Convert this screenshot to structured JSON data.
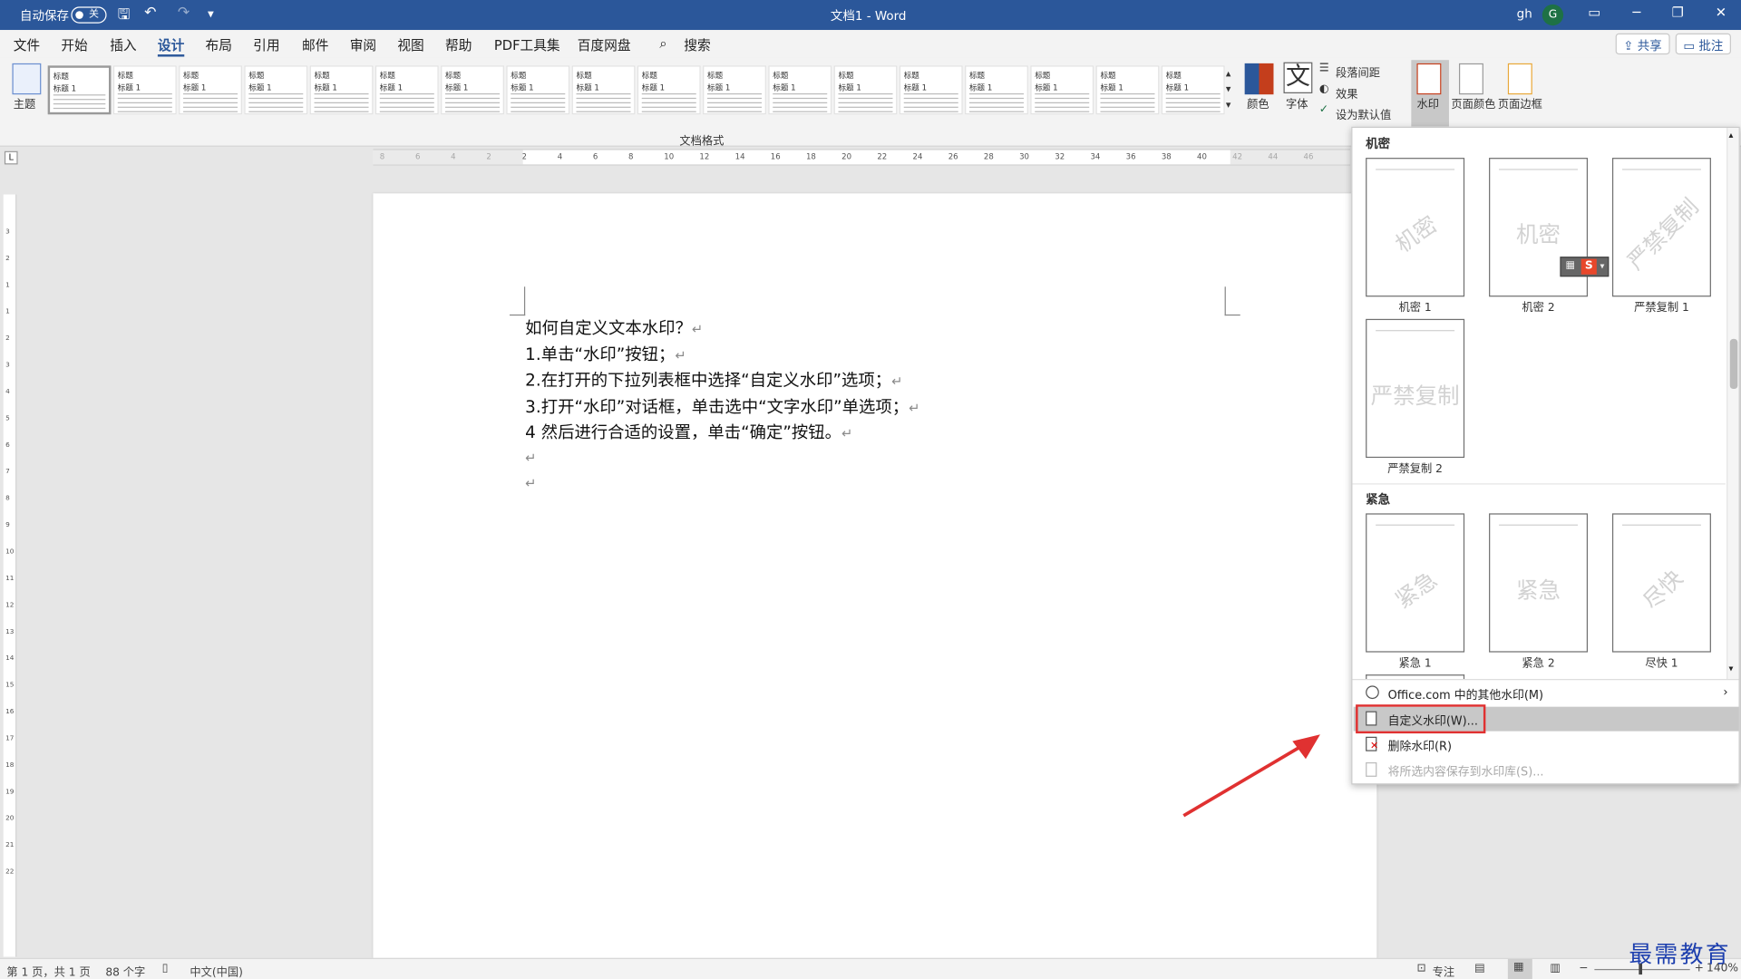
{
  "titlebar": {
    "autosave_label": "自动保存",
    "autosave_state": "关",
    "title": "文档1 - Word",
    "user": "gh",
    "avatar_initial": "G"
  },
  "tabs": [
    "文件",
    "开始",
    "插入",
    "设计",
    "布局",
    "引用",
    "邮件",
    "审阅",
    "视图",
    "帮助",
    "PDF工具集",
    "百度网盘"
  ],
  "active_tab": "设计",
  "search_label": "搜索",
  "share_label": "共享",
  "comment_label": "批注",
  "ribbon": {
    "theme_label": "主题",
    "styles_group_label": "文档格式",
    "style_thumbs": [
      "标题",
      "标题",
      "标题",
      "标题",
      "标题",
      "标题",
      "标题",
      "标题",
      "标题",
      "标题",
      "标题",
      "标题",
      "标题",
      "标题",
      "标题",
      "标题",
      "标题",
      "标题"
    ],
    "style_sub": "标题 1",
    "colors_label": "颜色",
    "fonts_label": "字体",
    "font_glyph": "文",
    "para_spacing_label": "段落间距",
    "effects_label": "效果",
    "set_default_label": "设为默认值",
    "watermark_label": "水印",
    "page_color_label": "页面颜色",
    "page_border_label": "页面边框"
  },
  "ruler_numbers": [
    "8",
    "6",
    "4",
    "2",
    "2",
    "4",
    "6",
    "8",
    "10",
    "12",
    "14",
    "16",
    "18",
    "20",
    "22",
    "24",
    "26",
    "28",
    "30",
    "32",
    "34",
    "36",
    "38",
    "40",
    "42",
    "44",
    "46"
  ],
  "vruler_numbers": [
    "3",
    "2",
    "1",
    "1",
    "2",
    "3",
    "4",
    "5",
    "6",
    "7",
    "8",
    "9",
    "10",
    "11",
    "12",
    "13",
    "14",
    "15",
    "16",
    "17",
    "18",
    "19",
    "20",
    "21",
    "22"
  ],
  "document": {
    "lines": [
      "如何自定义文本水印？",
      "1.单击“水印”按钮；",
      "2.在打开的下拉列表框中选择“自定义水印”选项；",
      "3.打开“水印”对话框，单击选中“文字水印”单选项；",
      "4 然后进行合适的设置，单击“确定”按钮。",
      "",
      ""
    ],
    "para_mark": "↵"
  },
  "watermark_gallery": {
    "sections": [
      {
        "title": "机密",
        "items": [
          {
            "text": "机密",
            "caption": "机密 1"
          },
          {
            "text": "机密",
            "caption": "机密 2"
          },
          {
            "text": "严禁复制",
            "caption": "严禁复制 1"
          },
          {
            "text": "严禁复制",
            "caption": "严禁复制 2"
          }
        ]
      },
      {
        "title": "紧急",
        "items": [
          {
            "text": "紧急",
            "caption": "紧急 1"
          },
          {
            "text": "紧急",
            "caption": "紧急 2"
          },
          {
            "text": "尽快",
            "caption": "尽快 1"
          }
        ]
      }
    ]
  },
  "menu": [
    {
      "label": "Office.com 中的其他水印(M)",
      "enabled": true
    },
    {
      "label": "自定义水印(W)...",
      "enabled": true,
      "highlighted": true
    },
    {
      "label": "删除水印(R)",
      "enabled": true
    },
    {
      "label": "将所选内容保存到水印库(S)...",
      "enabled": false
    }
  ],
  "statusbar": {
    "page": "第 1 页，共 1 页",
    "words": "88 个字",
    "language": "中文(中国)",
    "focus": "专注",
    "zoom": "140%"
  },
  "brand": "最需教育",
  "colors": {
    "titlebar": "#2b579a",
    "highlight_border": "#e03131",
    "arrow": "#e03131",
    "brand": "#1d3fae"
  }
}
